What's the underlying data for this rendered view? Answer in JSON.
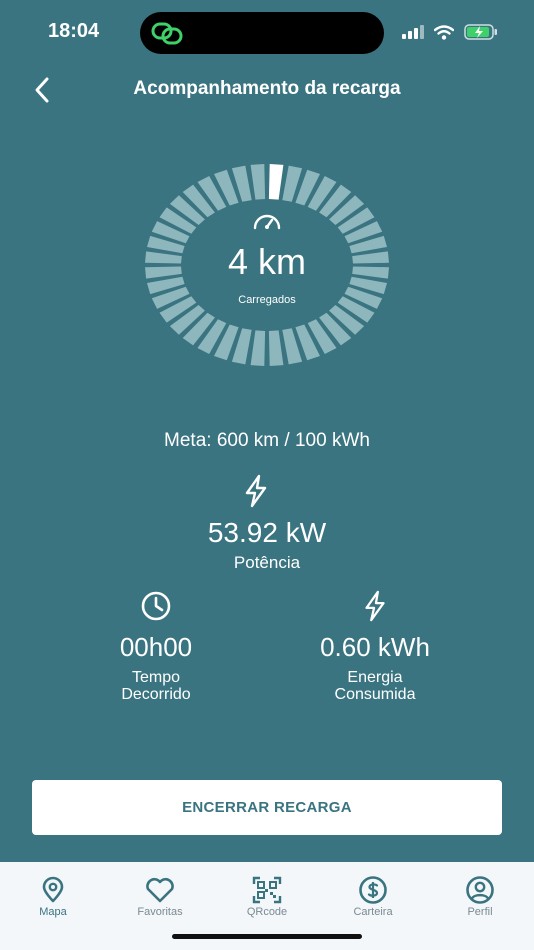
{
  "status_bar": {
    "time": "18:04",
    "island_icon": "chain-link-icon",
    "signal_icon": "cellular-signal-icon",
    "wifi_icon": "wifi-icon",
    "battery_icon": "battery-charging-icon"
  },
  "header": {
    "back_icon": "chevron-left-icon",
    "title": "Acompanhamento da recarga"
  },
  "gauge": {
    "icon": "speedometer-icon",
    "value": "4 km",
    "label": "Carregados",
    "progress_fraction": 0.0067
  },
  "charging": {
    "meta": "Meta: 600 km / 100 kWh",
    "power_icon": "lightning-bolt-icon",
    "power_value": "53.92 kW",
    "power_label": "Potência",
    "elapsed_icon": "clock-icon",
    "elapsed_value": "00h00",
    "elapsed_label_line1": "Tempo",
    "elapsed_label_line2": "Decorrido",
    "energy_icon": "lightning-bolt-icon",
    "energy_value": "0.60 kWh",
    "energy_label_line1": "Energia",
    "energy_label_line2": "Consumida"
  },
  "actions": {
    "end_label": "ENCERRAR RECARGA"
  },
  "bottom_nav": {
    "items": [
      {
        "label": "Mapa",
        "icon": "map-pin-icon",
        "active": true
      },
      {
        "label": "Favoritas",
        "icon": "heart-icon",
        "active": false
      },
      {
        "label": "QRcode",
        "icon": "qr-code-icon",
        "active": false
      },
      {
        "label": "Carteira",
        "icon": "dollar-coin-icon",
        "active": false
      },
      {
        "label": "Perfil",
        "icon": "user-circle-icon",
        "active": false
      }
    ]
  },
  "colors": {
    "background": "#3a7480",
    "nav_background": "#f4f7fa",
    "accent": "#3a7480",
    "inactive": "#7a8a92"
  }
}
